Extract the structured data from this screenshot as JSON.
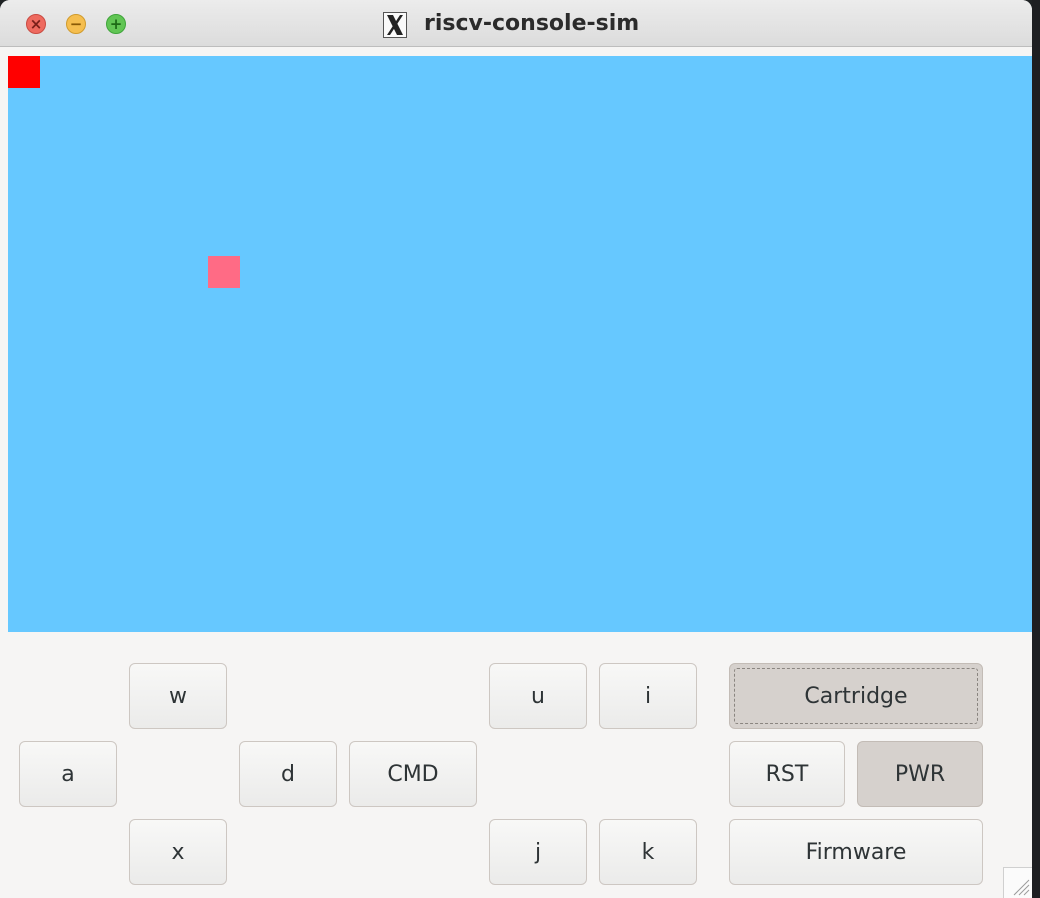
{
  "window": {
    "title": "riscv-console-sim"
  },
  "colors": {
    "screen_background": "#66c8ff",
    "sprite_red": "#ff0000",
    "sprite_pink": "#ff6b85",
    "button_pressed": "#d6d1cd"
  },
  "titlebar_icons": [
    "close-icon",
    "minimize-icon",
    "maximize-icon",
    "x11-app-icon"
  ],
  "controls": {
    "dpad": {
      "up": "w",
      "left": "a",
      "right": "d",
      "down": "x"
    },
    "cmd": "CMD",
    "action": {
      "u": "u",
      "i": "i",
      "j": "j",
      "k": "k"
    },
    "system": {
      "cartridge": "Cartridge",
      "rst": "RST",
      "pwr": "PWR",
      "firmware": "Firmware"
    }
  }
}
